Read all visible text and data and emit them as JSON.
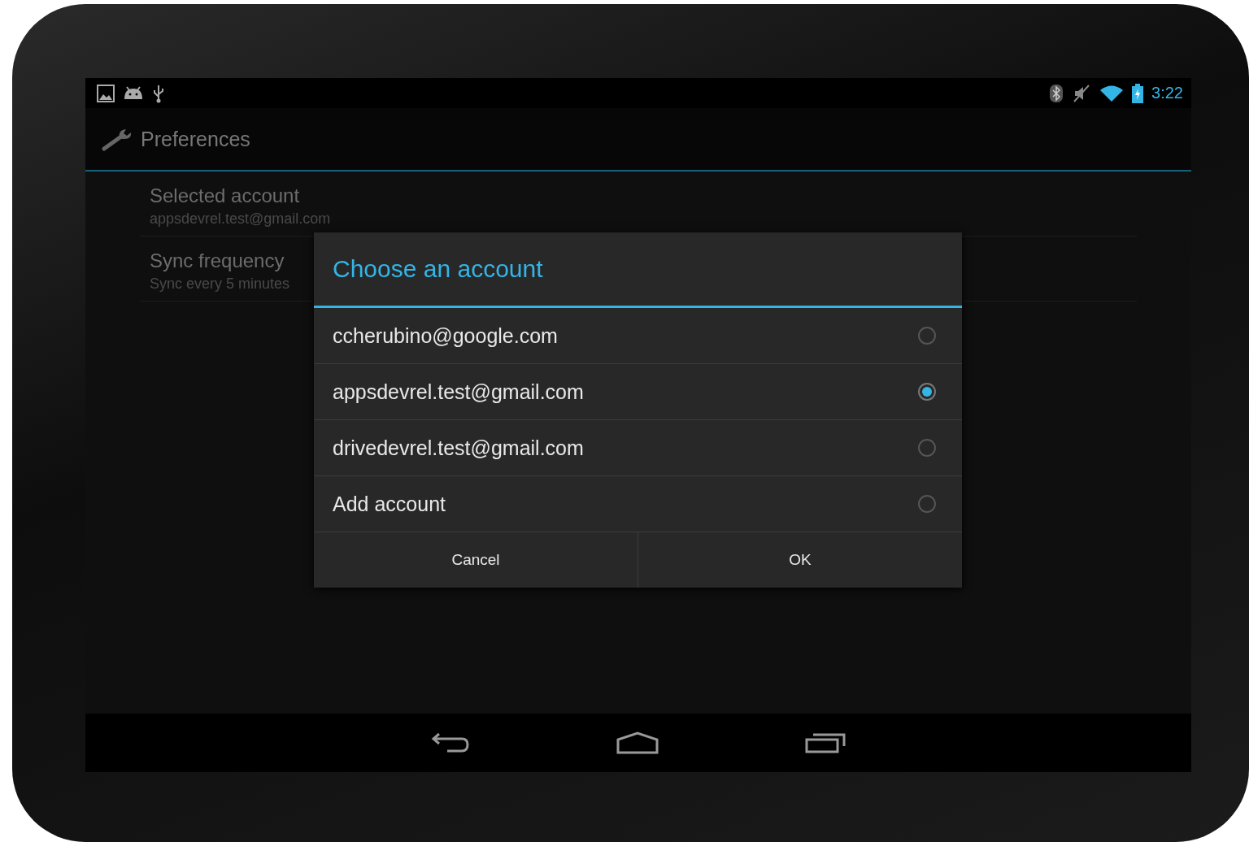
{
  "status_bar": {
    "time": "3:22"
  },
  "action_bar": {
    "title": "Preferences"
  },
  "preferences": [
    {
      "title": "Selected account",
      "summary": "appsdevrel.test@gmail.com"
    },
    {
      "title": "Sync frequency",
      "summary": "Sync every 5 minutes"
    }
  ],
  "dialog": {
    "title": "Choose an account",
    "options": [
      {
        "label": "ccherubino@google.com",
        "selected": false
      },
      {
        "label": "appsdevrel.test@gmail.com",
        "selected": true
      },
      {
        "label": "drivedevrel.test@gmail.com",
        "selected": false
      },
      {
        "label": "Add account",
        "selected": false
      }
    ],
    "buttons": [
      "Cancel",
      "OK"
    ]
  }
}
